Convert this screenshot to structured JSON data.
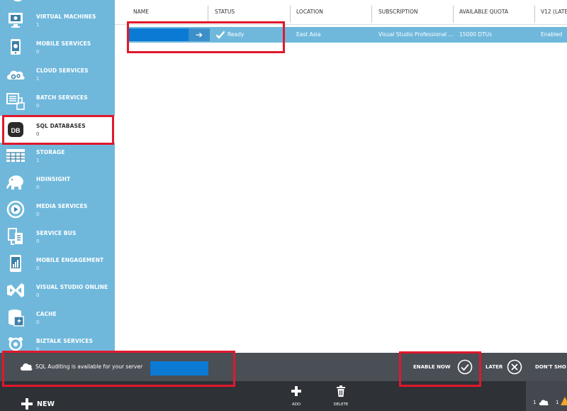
{
  "colors": {
    "sidebar": "#6fb8dc",
    "selected_row": "#6fb8dc",
    "redacted": "#0a7ad4",
    "notification_bar": "#4a4e55",
    "command_bar": "#2e3136",
    "highlight": "#e0182d",
    "warning": "#f5a623"
  },
  "sidebar": {
    "items": [
      {
        "label": "VIRTUAL MACHINES",
        "count": "1",
        "icon": "virtual-machine-icon"
      },
      {
        "label": "MOBILE SERVICES",
        "count": "0",
        "icon": "mobile-services-icon"
      },
      {
        "label": "CLOUD SERVICES",
        "count": "1",
        "icon": "cloud-services-icon"
      },
      {
        "label": "BATCH SERVICES",
        "count": "0",
        "icon": "batch-services-icon"
      },
      {
        "label": "SQL DATABASES",
        "count": "0",
        "icon": "database-icon",
        "selected": true
      },
      {
        "label": "STORAGE",
        "count": "1",
        "icon": "storage-icon"
      },
      {
        "label": "HDINSIGHT",
        "count": "0",
        "icon": "elephant-icon"
      },
      {
        "label": "MEDIA SERVICES",
        "count": "0",
        "icon": "media-services-icon"
      },
      {
        "label": "SERVICE BUS",
        "count": "0",
        "icon": "service-bus-icon"
      },
      {
        "label": "MOBILE ENGAGEMENT",
        "count": "0",
        "icon": "mobile-engagement-icon"
      },
      {
        "label": "VISUAL STUDIO ONLINE",
        "count": "0",
        "icon": "visual-studio-icon"
      },
      {
        "label": "CACHE",
        "count": "0",
        "icon": "cache-icon"
      },
      {
        "label": "BIZTALK SERVICES",
        "count": "0",
        "icon": "biztalk-icon"
      }
    ]
  },
  "grid": {
    "columns": [
      "NAME",
      "STATUS",
      "LOCATION",
      "SUBSCRIPTION",
      "AVAILABLE QUOTA",
      "V12 (LATE"
    ],
    "rows": [
      {
        "status": "Ready",
        "location": "East Asia",
        "subscription": "Visual Studio Professional ...",
        "quota": "15000 DTUs",
        "v12": "Enabled"
      }
    ]
  },
  "notification": {
    "message": "SQL Auditing is available for your server",
    "enable_now": "ENABLE NOW",
    "later": "LATER",
    "dont_show": "DON'T SHO"
  },
  "command_bar": {
    "new_label": "NEW",
    "add_label": "ADD",
    "delete_label": "DELETE",
    "cloud_count": "1",
    "warning_count": "1"
  }
}
